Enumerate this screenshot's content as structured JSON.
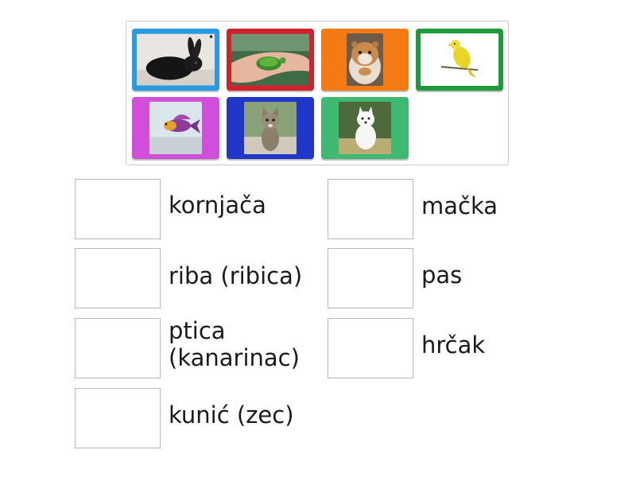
{
  "tiles": [
    {
      "id": "rabbit",
      "icon": "rabbit-photo",
      "color": "#2a9ae0"
    },
    {
      "id": "turtle",
      "icon": "turtle-photo",
      "color": "#d0212f"
    },
    {
      "id": "hamster",
      "icon": "hamster-photo",
      "color": "#f47b14"
    },
    {
      "id": "canary",
      "icon": "canary-photo",
      "color": "#1f9a3a"
    },
    {
      "id": "fish",
      "icon": "fish-photo",
      "color": "#cf4fd8"
    },
    {
      "id": "cat",
      "icon": "cat-photo",
      "color": "#1f36c9"
    },
    {
      "id": "dog",
      "icon": "dog-photo",
      "color": "#3fb871"
    }
  ],
  "targets": [
    {
      "label": "kornjača"
    },
    {
      "label": "mačka"
    },
    {
      "label": "riba (ribica)"
    },
    {
      "label": "pas"
    },
    {
      "label": "ptica (kanarinac)"
    },
    {
      "label": "hrčak"
    },
    {
      "label": "kunić (zec)"
    }
  ]
}
